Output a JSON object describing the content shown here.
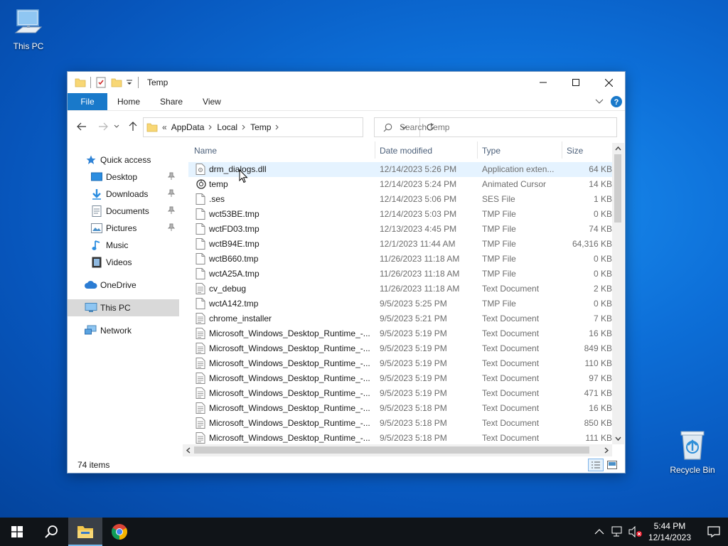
{
  "desktop": {
    "icons": [
      {
        "label": "This PC"
      },
      {
        "label": "Recycle Bin"
      }
    ]
  },
  "window": {
    "title": "Temp",
    "ribbon_tabs": [
      "File",
      "Home",
      "Share",
      "View"
    ],
    "address": {
      "crumbs": [
        "AppData",
        "Local",
        "Temp"
      ],
      "overflow": "«"
    },
    "search_placeholder": "Search Temp",
    "nav": {
      "quick_access": "Quick access",
      "desktop": "Desktop",
      "downloads": "Downloads",
      "documents": "Documents",
      "pictures": "Pictures",
      "music": "Music",
      "videos": "Videos",
      "onedrive": "OneDrive",
      "this_pc": "This PC",
      "network": "Network"
    },
    "columns": {
      "name": "Name",
      "date": "Date modified",
      "type": "Type",
      "size": "Size"
    },
    "files": [
      {
        "name": "drm_dialogs.dll",
        "date": "12/14/2023 5:26 PM",
        "type": "Application exten...",
        "size": "64 KB",
        "icon": "dll-file-icon"
      },
      {
        "name": "temp",
        "date": "12/14/2023 5:24 PM",
        "type": "Animated Cursor",
        "size": "14 KB",
        "icon": "cursor-file-icon"
      },
      {
        "name": ".ses",
        "date": "12/14/2023 5:06 PM",
        "type": "SES File",
        "size": "1 KB",
        "icon": "blank-file-icon"
      },
      {
        "name": "wct53BE.tmp",
        "date": "12/14/2023 5:03 PM",
        "type": "TMP File",
        "size": "0 KB",
        "icon": "blank-file-icon"
      },
      {
        "name": "wctFD03.tmp",
        "date": "12/13/2023 4:45 PM",
        "type": "TMP File",
        "size": "74 KB",
        "icon": "blank-file-icon"
      },
      {
        "name": "wctB94E.tmp",
        "date": "12/1/2023 11:44 AM",
        "type": "TMP File",
        "size": "64,316 KB",
        "icon": "blank-file-icon"
      },
      {
        "name": "wctB660.tmp",
        "date": "11/26/2023 11:18 AM",
        "type": "TMP File",
        "size": "0 KB",
        "icon": "blank-file-icon"
      },
      {
        "name": "wctA25A.tmp",
        "date": "11/26/2023 11:18 AM",
        "type": "TMP File",
        "size": "0 KB",
        "icon": "blank-file-icon"
      },
      {
        "name": "cv_debug",
        "date": "11/26/2023 11:18 AM",
        "type": "Text Document",
        "size": "2 KB",
        "icon": "text-file-icon"
      },
      {
        "name": "wctA142.tmp",
        "date": "9/5/2023 5:25 PM",
        "type": "TMP File",
        "size": "0 KB",
        "icon": "blank-file-icon"
      },
      {
        "name": "chrome_installer",
        "date": "9/5/2023 5:21 PM",
        "type": "Text Document",
        "size": "7 KB",
        "icon": "text-file-icon"
      },
      {
        "name": "Microsoft_Windows_Desktop_Runtime_-...",
        "date": "9/5/2023 5:19 PM",
        "type": "Text Document",
        "size": "16 KB",
        "icon": "text-file-icon"
      },
      {
        "name": "Microsoft_Windows_Desktop_Runtime_-...",
        "date": "9/5/2023 5:19 PM",
        "type": "Text Document",
        "size": "849 KB",
        "icon": "text-file-icon"
      },
      {
        "name": "Microsoft_Windows_Desktop_Runtime_-...",
        "date": "9/5/2023 5:19 PM",
        "type": "Text Document",
        "size": "110 KB",
        "icon": "text-file-icon"
      },
      {
        "name": "Microsoft_Windows_Desktop_Runtime_-...",
        "date": "9/5/2023 5:19 PM",
        "type": "Text Document",
        "size": "97 KB",
        "icon": "text-file-icon"
      },
      {
        "name": "Microsoft_Windows_Desktop_Runtime_-...",
        "date": "9/5/2023 5:19 PM",
        "type": "Text Document",
        "size": "471 KB",
        "icon": "text-file-icon"
      },
      {
        "name": "Microsoft_Windows_Desktop_Runtime_-...",
        "date": "9/5/2023 5:18 PM",
        "type": "Text Document",
        "size": "16 KB",
        "icon": "text-file-icon"
      },
      {
        "name": "Microsoft_Windows_Desktop_Runtime_-...",
        "date": "9/5/2023 5:18 PM",
        "type": "Text Document",
        "size": "850 KB",
        "icon": "text-file-icon"
      },
      {
        "name": "Microsoft_Windows_Desktop_Runtime_-...",
        "date": "9/5/2023 5:18 PM",
        "type": "Text Document",
        "size": "111 KB",
        "icon": "text-file-icon"
      }
    ],
    "status": "74 items"
  },
  "taskbar": {
    "time": "5:44 PM",
    "date": "12/14/2023"
  },
  "colors": {
    "accent": "#1979ca",
    "desktop": "#0d6fd8",
    "taskbar": "#101418",
    "selection": "#d9d9d9",
    "hover": "#e5f3ff"
  }
}
